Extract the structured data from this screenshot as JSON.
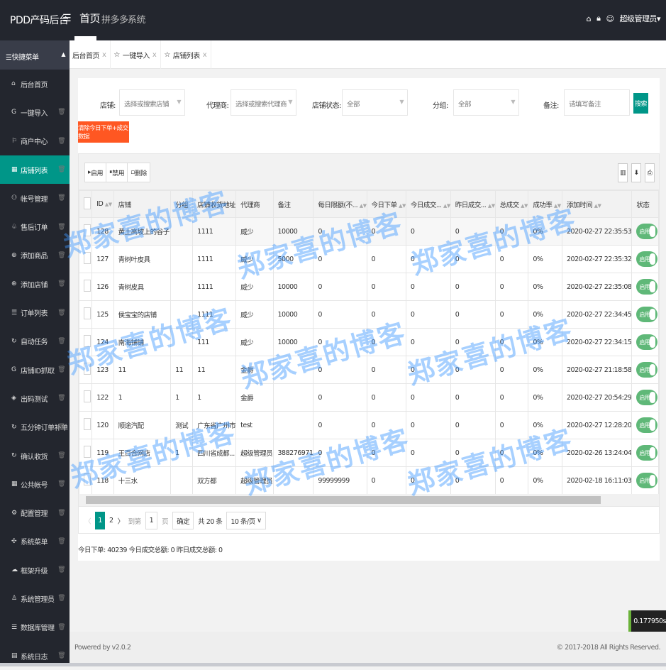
{
  "header": {
    "logo": "PDD产码后台",
    "nav": [
      "首页",
      "拼多多",
      "系统"
    ],
    "user": "超级管理员"
  },
  "sidebar": {
    "title": "快捷菜单",
    "items": [
      {
        "label": "后台首页",
        "icon": "home-icon"
      },
      {
        "label": "一键导入",
        "icon": "import-icon"
      },
      {
        "label": "商户中心",
        "icon": "flag-icon"
      },
      {
        "label": "店铺列表",
        "icon": "grid-icon"
      },
      {
        "label": "帐号管理",
        "icon": "users-icon"
      },
      {
        "label": "售后订单",
        "icon": "service-icon"
      },
      {
        "label": "添加商品",
        "icon": "add-circle-icon"
      },
      {
        "label": "添加店铺",
        "icon": "add-circle-icon"
      },
      {
        "label": "订单列表",
        "icon": "database-icon"
      },
      {
        "label": "自动任务",
        "icon": "sync-icon"
      },
      {
        "label": "店铺ID抓取",
        "icon": "import-icon"
      },
      {
        "label": "出码测试",
        "icon": "code-icon"
      },
      {
        "label": "五分钟订单补单",
        "icon": "sync-icon"
      },
      {
        "label": "确认收货",
        "icon": "sync-icon"
      },
      {
        "label": "公共帐号",
        "icon": "grid-icon"
      },
      {
        "label": "配置管理",
        "icon": "settings-icon"
      },
      {
        "label": "系统菜单",
        "icon": "menu-icon"
      },
      {
        "label": "框架升级",
        "icon": "cloud-icon"
      },
      {
        "label": "系统管理员",
        "icon": "admin-icon"
      },
      {
        "label": "数据库管理",
        "icon": "database-icon"
      },
      {
        "label": "系统日志",
        "icon": "log-icon"
      }
    ]
  },
  "tabs": [
    {
      "label": "后台首页"
    },
    {
      "label": "一键导入"
    },
    {
      "label": "店铺列表"
    }
  ],
  "filters": {
    "shop_label": "店铺:",
    "shop_placeholder": "选择或搜索店铺",
    "agent_label": "代理商:",
    "agent_placeholder": "选择或搜索代理商",
    "status_label": "店铺状态:",
    "status_value": "全部",
    "group_label": "分组:",
    "group_value": "全部",
    "note_label": "备注:",
    "note_placeholder": "请填写备注",
    "search": "搜索",
    "clear": "清除今日下单+成交数据"
  },
  "toolbar": {
    "enable": "启用",
    "disable": "禁用",
    "delete": "删除"
  },
  "table": {
    "columns": [
      "ID",
      "店铺",
      "分组",
      "店铺收货地址",
      "代理商",
      "备注",
      "每日限额(不...",
      "今日下单",
      "今日成交...",
      "昨日成交...",
      "总成交",
      "成功率",
      "添加时间",
      "状态"
    ],
    "rows": [
      [
        "128",
        "黄土高坡上的谷子",
        "",
        "1111",
        "威少",
        "10000",
        "0",
        "0",
        "0",
        "0",
        "0",
        "0%",
        "2020-02-27 22:35:53",
        "启用"
      ],
      [
        "127",
        "青树叶皮具",
        "",
        "1111",
        "威少",
        "5000",
        "0",
        "0",
        "0",
        "0",
        "0",
        "0%",
        "2020-02-27 22:35:32",
        "启用"
      ],
      [
        "126",
        "青树皮具",
        "",
        "1111",
        "威少",
        "10000",
        "0",
        "0",
        "0",
        "0",
        "0",
        "0%",
        "2020-02-27 22:35:08",
        "启用"
      ],
      [
        "125",
        "侯宝宝的店铺",
        "",
        "1111",
        "威少",
        "10000",
        "0",
        "0",
        "0",
        "0",
        "0",
        "0%",
        "2020-02-27 22:34:45",
        "启用"
      ],
      [
        "124",
        "南海铺铺",
        "",
        "111",
        "威少",
        "10000",
        "0",
        "0",
        "0",
        "0",
        "0",
        "0%",
        "2020-02-27 22:34:15",
        "启用"
      ],
      [
        "123",
        "11",
        "11",
        "11",
        "金爵",
        "",
        "0",
        "0",
        "0",
        "0",
        "0",
        "0%",
        "2020-02-27 21:18:58",
        "启用"
      ],
      [
        "122",
        "1",
        "1",
        "1",
        "金爵",
        "",
        "0",
        "0",
        "0",
        "0",
        "0",
        "0%",
        "2020-02-27 20:54:29",
        "启用"
      ],
      [
        "120",
        "顺途汽配",
        "测试",
        "广东省广州市",
        "test",
        "",
        "0",
        "0",
        "0",
        "0",
        "0",
        "0%",
        "2020-02-27 12:28:20",
        "启用"
      ],
      [
        "119",
        "王百合网店",
        "1",
        "四川省成都...",
        "超级管理员",
        "388276971",
        "0",
        "0",
        "0",
        "0",
        "0",
        "0%",
        "2020-02-26 13:24:04",
        "启用"
      ],
      [
        "118",
        "十三水",
        "",
        "双方都",
        "超级管理员",
        "",
        "99999999",
        "0",
        "0",
        "0",
        "0",
        "0%",
        "2020-02-18 16:11:03",
        "启用"
      ]
    ]
  },
  "pager": {
    "prev": "〈",
    "pages": [
      "1",
      "2"
    ],
    "next": "〉",
    "goto": "到第",
    "page_input": "1",
    "page_unit": "页",
    "confirm": "确定",
    "total": "共 20 条",
    "per_page": "10 条/页"
  },
  "stats": "今日下单: 40239 今日成交总额: 0 昨日成交总额: 0",
  "footer": {
    "powered": "Powered by v2.0.2",
    "copyright": "© 2017-2018 All Rights Reserved."
  },
  "timer": "0.177950s",
  "watermark": "郑家喜的博客",
  "colors": {
    "primary": "#009688",
    "danger": "#ff5722",
    "switch_on": "#5fb878",
    "header": "#23262e"
  }
}
